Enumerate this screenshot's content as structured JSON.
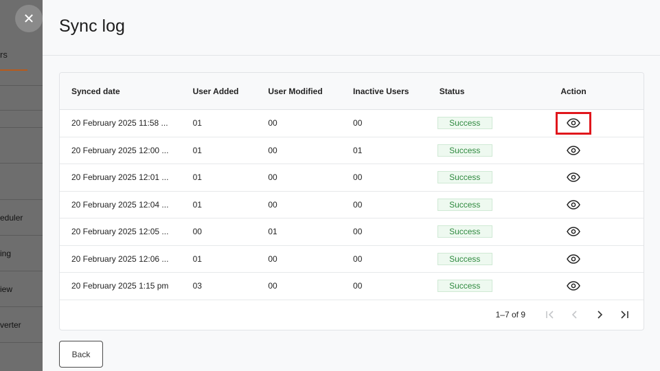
{
  "underlay": {
    "tab_label": "rs",
    "items": [
      "eduler",
      "ing",
      "iew",
      "verter"
    ]
  },
  "drawer": {
    "title": "Sync log",
    "close_icon": "close-icon"
  },
  "table": {
    "columns": [
      "Synced date",
      "User Added",
      "User Modified",
      "Inactive Users",
      "Status",
      "Action"
    ],
    "rows": [
      {
        "date": "20 February 2025 11:58 ...",
        "added": "01",
        "modified": "00",
        "inactive": "00",
        "status": "Success"
      },
      {
        "date": "20 February 2025 12:00 ...",
        "added": "01",
        "modified": "00",
        "inactive": "01",
        "status": "Success"
      },
      {
        "date": "20 February 2025 12:01 ...",
        "added": "01",
        "modified": "00",
        "inactive": "00",
        "status": "Success"
      },
      {
        "date": "20 February 2025 12:04 ...",
        "added": "01",
        "modified": "00",
        "inactive": "00",
        "status": "Success"
      },
      {
        "date": "20 February 2025 12:05 ...",
        "added": "00",
        "modified": "01",
        "inactive": "00",
        "status": "Success"
      },
      {
        "date": "20 February 2025 12:06 ...",
        "added": "01",
        "modified": "00",
        "inactive": "00",
        "status": "Success"
      },
      {
        "date": "20 February 2025 1:15 pm",
        "added": "03",
        "modified": "00",
        "inactive": "00",
        "status": "Success"
      }
    ]
  },
  "pagination": {
    "range_text": "1–7 of 9"
  },
  "footer": {
    "back_label": "Back"
  },
  "colors": {
    "success_text": "#2f8a3f",
    "success_bg": "#eef9f0",
    "highlight": "#e0161c",
    "accent_tab": "#b85a1c"
  }
}
